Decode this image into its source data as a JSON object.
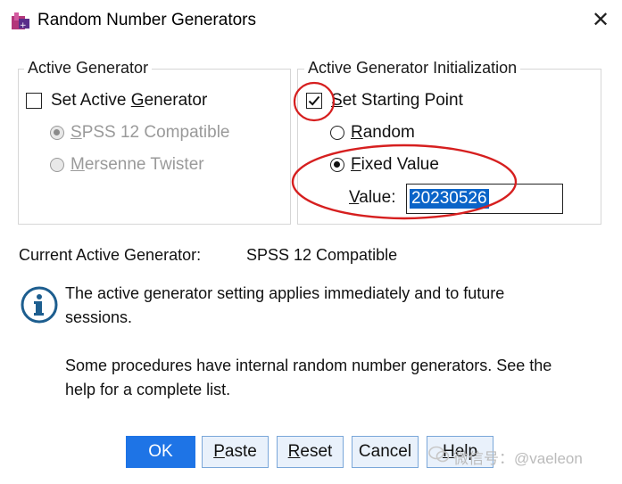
{
  "window": {
    "title": "Random Number Generators",
    "close_glyph": "✕"
  },
  "active_generator": {
    "group_label": "Active Generator",
    "set_active_label_pre": "Set Active ",
    "set_active_label_u": "G",
    "set_active_label_post": "enerator",
    "set_active_checked": false,
    "options": [
      {
        "u": "S",
        "rest": "PSS 12 Compatible",
        "selected": true,
        "enabled": false
      },
      {
        "u": "M",
        "rest": "ersenne Twister",
        "selected": false,
        "enabled": false
      }
    ]
  },
  "initialization": {
    "group_label": "Active Generator Initialization",
    "set_start_u": "S",
    "set_start_rest": "et Starting Point",
    "set_start_checked": true,
    "random_u": "R",
    "random_rest": "andom",
    "random_selected": false,
    "fixed_u": "F",
    "fixed_rest": "ixed Value",
    "fixed_selected": true,
    "value_u": "V",
    "value_rest": "alue:",
    "value": "20230526"
  },
  "current": {
    "label": "Current Active Generator:",
    "value": "SPSS 12 Compatible"
  },
  "info": {
    "line1": "The active generator setting applies immediately and to future",
    "line2": "sessions.",
    "line3": "Some procedures have internal random number generators.  See the",
    "line4": "help for a complete list."
  },
  "buttons": {
    "ok": "OK",
    "paste_u": "P",
    "paste_rest": "aste",
    "reset_u": "R",
    "reset_rest": "eset",
    "cancel": "Cancel",
    "help_u": "H",
    "help_rest": "elp"
  },
  "watermark": {
    "text": "微信号：@vaeleon"
  },
  "annotation_color": "#d61f1f"
}
